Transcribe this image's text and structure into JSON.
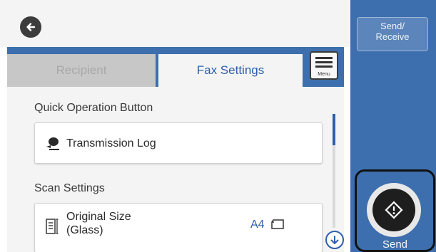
{
  "header": {
    "back_icon": "back-arrow-icon"
  },
  "tabs": [
    {
      "label": "Recipient",
      "state": "disabled"
    },
    {
      "label": "Fax Settings",
      "state": "selected"
    }
  ],
  "menu_button": {
    "label": "Menu",
    "icon": "menu-icon"
  },
  "sections": {
    "quick_operation": {
      "title": "Quick Operation Button",
      "items": [
        {
          "label": "Transmission Log",
          "icon": "transmission-log-icon"
        }
      ]
    },
    "scan_settings": {
      "title": "Scan Settings",
      "items": [
        {
          "label_line1": "Original Size",
          "label_line2": "(Glass)",
          "value": "A4",
          "icon": "original-size-icon",
          "value_icon": "paper-orientation-icon"
        }
      ]
    }
  },
  "side_panel": {
    "send_receive": {
      "line1": "Send/",
      "line2": "Receive"
    },
    "send": {
      "label": "Send",
      "icon": "start-diamond-icon"
    }
  },
  "colors": {
    "accent_blue": "#3d6fae",
    "tab_active_text": "#2d5fa6",
    "disabled_tab": "#c7c7c7"
  }
}
